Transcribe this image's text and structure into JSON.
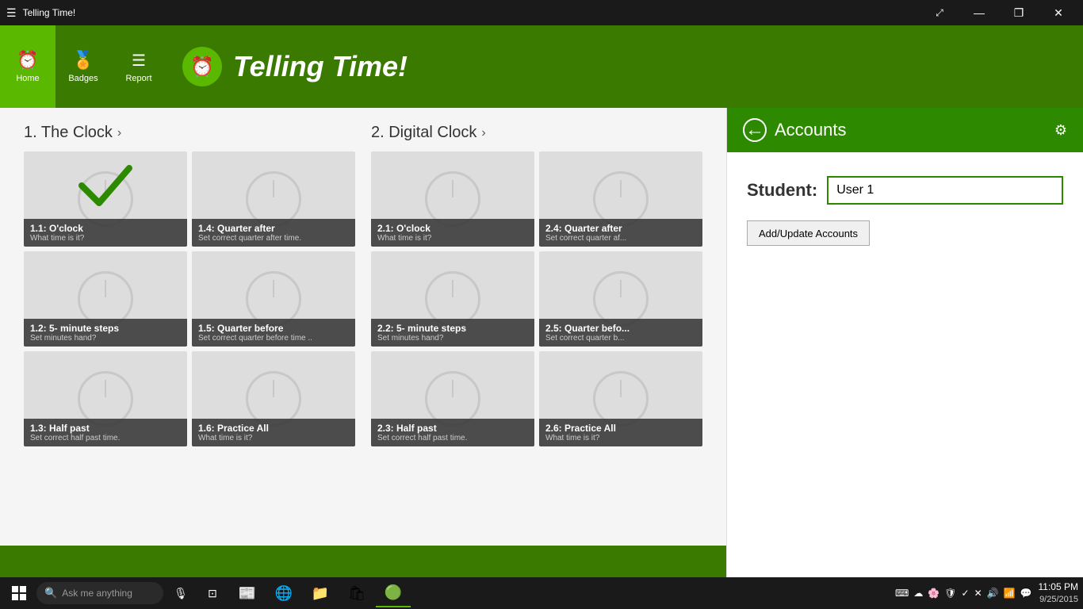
{
  "titleBar": {
    "appName": "Telling Time!",
    "controls": [
      "—",
      "❐",
      "✕"
    ]
  },
  "navBar": {
    "buttons": [
      {
        "id": "home",
        "label": "Home",
        "icon": "⏰",
        "active": true
      },
      {
        "id": "badges",
        "label": "Badges",
        "icon": "🏅",
        "active": false
      },
      {
        "id": "report",
        "label": "Report",
        "icon": "☰",
        "active": false
      }
    ]
  },
  "appHeader": {
    "title": "Telling Time!"
  },
  "sections": [
    {
      "id": "section1",
      "title": "1. The Clock",
      "cards": [
        {
          "id": "1.1",
          "title": "1.1: O'clock",
          "subtitle": "What time is it?",
          "hasCheck": true
        },
        {
          "id": "1.4",
          "title": "1.4: Quarter after",
          "subtitle": "Set correct quarter after time.",
          "hasCheck": false
        },
        {
          "id": "1.2",
          "title": "1.2: 5- minute steps",
          "subtitle": "Set minutes hand?",
          "hasCheck": false
        },
        {
          "id": "1.5",
          "title": "1.5: Quarter before",
          "subtitle": "Set correct quarter before time ..",
          "hasCheck": false
        },
        {
          "id": "1.3",
          "title": "1.3: Half past",
          "subtitle": "Set correct half past time.",
          "hasCheck": false
        },
        {
          "id": "1.6",
          "title": "1.6: Practice All",
          "subtitle": "What time is it?",
          "hasCheck": false
        }
      ]
    },
    {
      "id": "section2",
      "title": "2. Digital Clock",
      "cards": [
        {
          "id": "2.1",
          "title": "2.1: O'clock",
          "subtitle": "What time is it?",
          "hasCheck": false
        },
        {
          "id": "2.4",
          "title": "2.4: Quarter after",
          "subtitle": "Set correct quarter af...",
          "hasCheck": false
        },
        {
          "id": "2.2",
          "title": "2.2: 5- minute steps",
          "subtitle": "Set minutes hand?",
          "hasCheck": false
        },
        {
          "id": "2.5",
          "title": "2.5: Quarter befo...",
          "subtitle": "Set correct quarter b...",
          "hasCheck": false
        },
        {
          "id": "2.3",
          "title": "2.3: Half past",
          "subtitle": "Set correct half past time.",
          "hasCheck": false
        },
        {
          "id": "2.6",
          "title": "2.6: Practice All",
          "subtitle": "What time is it?",
          "hasCheck": false
        }
      ]
    }
  ],
  "accounts": {
    "headerTitle": "Accounts",
    "studentLabel": "Student:",
    "studentValue": "User 1",
    "addUpdateLabel": "Add/Update Accounts"
  },
  "taskbar": {
    "time": "11:05 PM",
    "date": "9/25/2015",
    "apps": [
      "⊞",
      "🔍",
      "🎙",
      "⊡",
      "📰",
      "🌐",
      "📁",
      "🛍",
      "🟢"
    ],
    "searchPlaceholder": "Ask me anything"
  }
}
